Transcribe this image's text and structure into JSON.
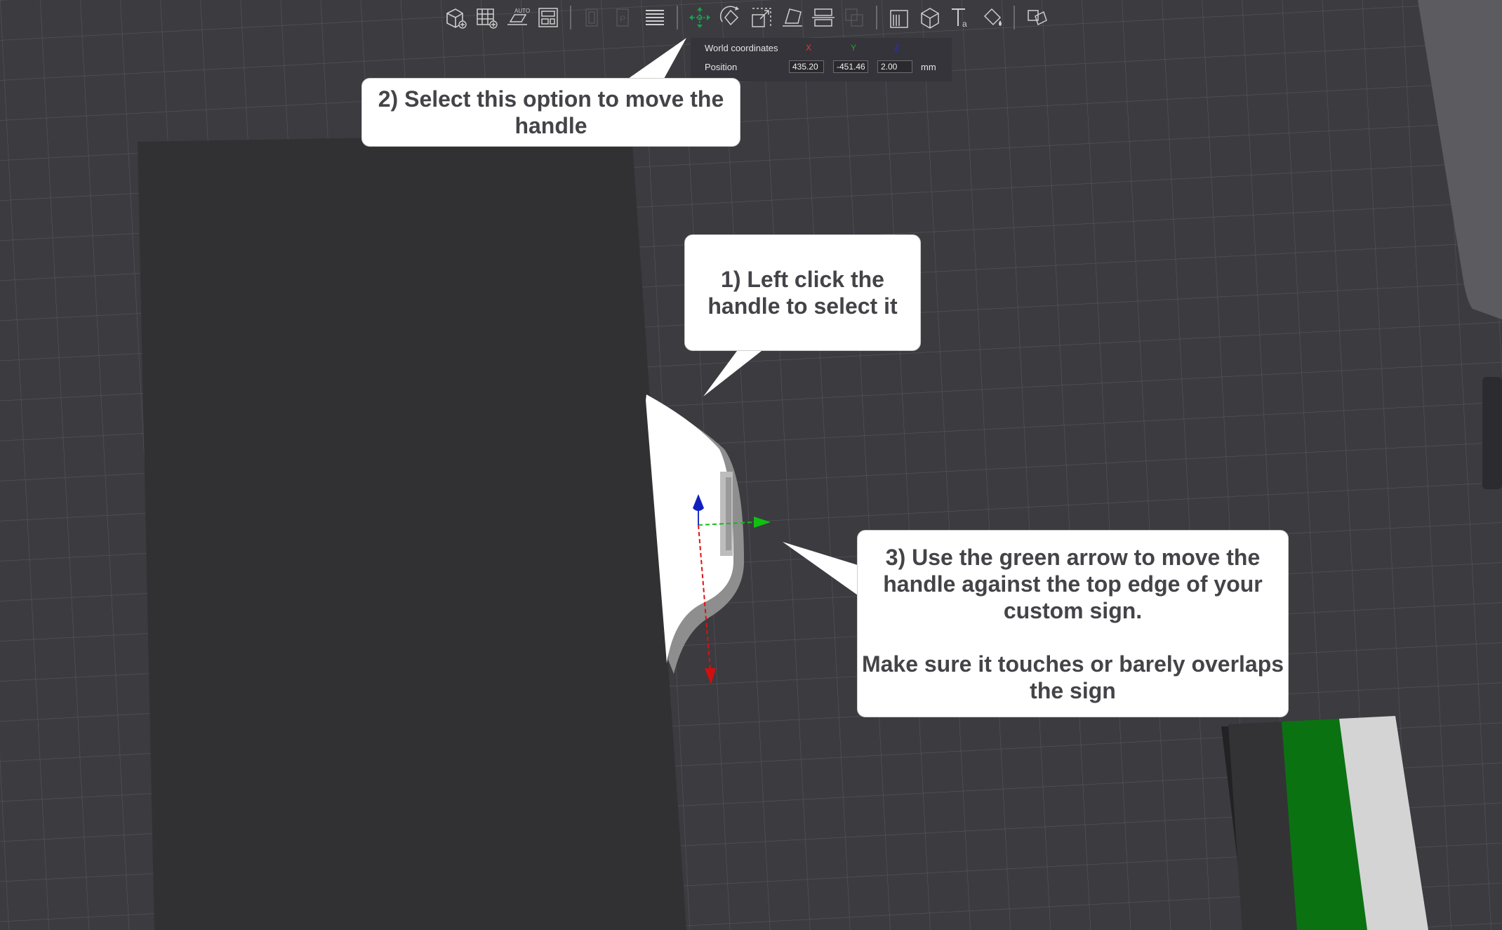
{
  "toolbar": {
    "buttons": [
      {
        "icon": "add-object-icon",
        "label": "Add"
      },
      {
        "icon": "arrange-grid-icon",
        "label": "Arrange"
      },
      {
        "icon": "auto-orient-icon",
        "label": "Auto orient"
      },
      {
        "icon": "plate-layout-icon",
        "label": "Layout"
      },
      {
        "icon": "copy-icon",
        "label": "Copy"
      },
      {
        "icon": "paste-icon",
        "label": "Paste"
      },
      {
        "icon": "layers-icon",
        "label": "Layers"
      },
      {
        "icon": "move-icon",
        "label": "Move"
      },
      {
        "icon": "rotate-icon",
        "label": "Rotate"
      },
      {
        "icon": "scale-icon",
        "label": "Scale"
      },
      {
        "icon": "lay-on-face-icon",
        "label": "Lay on face"
      },
      {
        "icon": "cut-icon",
        "label": "Cut"
      },
      {
        "icon": "boolean-icon",
        "label": "Boolean"
      },
      {
        "icon": "support-paint-icon",
        "label": "Support painting"
      },
      {
        "icon": "seam-paint-icon",
        "label": "Seam painting"
      },
      {
        "icon": "text-icon",
        "label": "Text"
      },
      {
        "icon": "color-paint-icon",
        "label": "Color painting"
      },
      {
        "icon": "assembly-icon",
        "label": "Assembly"
      }
    ]
  },
  "coord_panel": {
    "title": "World coordinates",
    "axis_x": "X",
    "axis_y": "Y",
    "axis_z": "Z",
    "row_label": "Position",
    "x": "435.20",
    "y": "-451.46",
    "z": "2.00",
    "unit": "mm"
  },
  "callouts": {
    "step2": "2) Select this option to move the handle",
    "step1": "1) Left click the handle to select it",
    "step3_line1": "3) Use the green arrow to move the handle against the top edge of your custom sign.",
    "step3_line2": "Make sure it touches or barely overlaps the sign"
  },
  "colors": {
    "background": "#3b3b40",
    "sign_body": "#313133",
    "gizmo_x": "#e01010",
    "gizmo_y": "#10c010",
    "gizmo_z": "#1020c0",
    "active_tool": "#16a34a"
  }
}
